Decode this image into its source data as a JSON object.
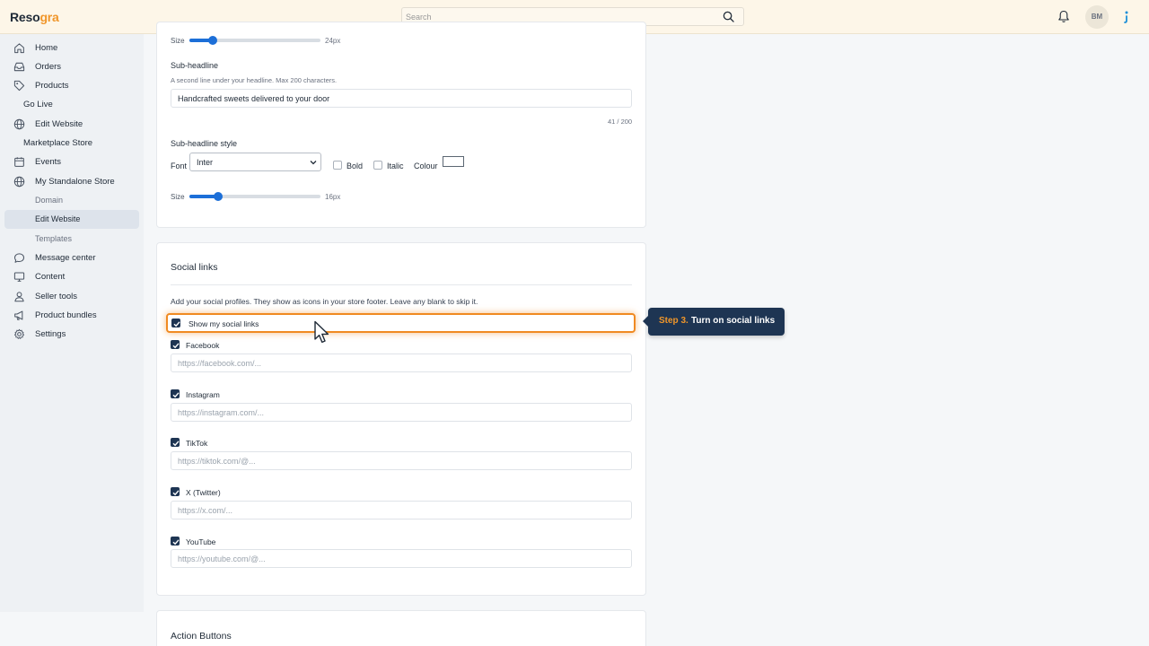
{
  "app": {
    "logo_part1": "Reso",
    "logo_part2": "gra",
    "search_placeholder": "Search",
    "avatar_initials": "BM"
  },
  "sidebar": {
    "items": [
      {
        "label": "Home",
        "icon": "home-icon"
      },
      {
        "label": "Orders",
        "icon": "inbox-icon"
      },
      {
        "label": "Products",
        "icon": "tag-icon"
      },
      {
        "label": "Go Live"
      },
      {
        "label": "Edit Website",
        "icon": "globe-icon"
      },
      {
        "label": "Marketplace Store"
      },
      {
        "label": "Events",
        "icon": "calendar-icon"
      },
      {
        "label": "My Standalone Store",
        "icon": "globe-icon"
      },
      {
        "label": "Domain"
      },
      {
        "label": "Edit Website",
        "active": true
      },
      {
        "label": "Templates"
      },
      {
        "label": "Message center",
        "icon": "chat-icon"
      },
      {
        "label": "Content",
        "icon": "monitor-icon"
      },
      {
        "label": "Seller tools",
        "icon": "user-icon"
      },
      {
        "label": "Product bundles",
        "icon": "megaphone-icon"
      },
      {
        "label": "Settings",
        "icon": "gear-icon"
      }
    ]
  },
  "headline_card": {
    "size_label": "Size",
    "size_value": "24px",
    "size_level": 0.18,
    "subheadline_label": "Sub-headline",
    "subheadline_help": "A second line under your headline. Max 200 characters.",
    "subheadline_value": "Handcrafted sweets delivered to your door",
    "char_count": "41 / 200",
    "style_label": "Sub-headline style",
    "font_label": "Font",
    "font_value": "Inter",
    "bold_label": "Bold",
    "italic_label": "Italic",
    "colour_label": "Colour",
    "sub_size_label": "Size",
    "sub_size_value": "16px",
    "sub_size_level": 0.22
  },
  "social_card": {
    "title": "Social links",
    "description": "Add your social profiles. They show as icons in your store footer. Leave any blank to skip it.",
    "show_label": "Show my social links",
    "links": [
      {
        "label": "Facebook",
        "placeholder": "https://facebook.com/..."
      },
      {
        "label": "Instagram",
        "placeholder": "https://instagram.com/..."
      },
      {
        "label": "TikTok",
        "placeholder": "https://tiktok.com/@..."
      },
      {
        "label": "X (Twitter)",
        "placeholder": "https://x.com/..."
      },
      {
        "label": "YouTube",
        "placeholder": "https://youtube.com/@..."
      }
    ]
  },
  "action_card": {
    "title": "Action Buttons"
  },
  "tooltip": {
    "step": "Step 3.",
    "text": "Turn on social links"
  },
  "colors": {
    "accent": "#f0962a",
    "navy": "#1e3553",
    "slider": "#1c6fd8"
  }
}
